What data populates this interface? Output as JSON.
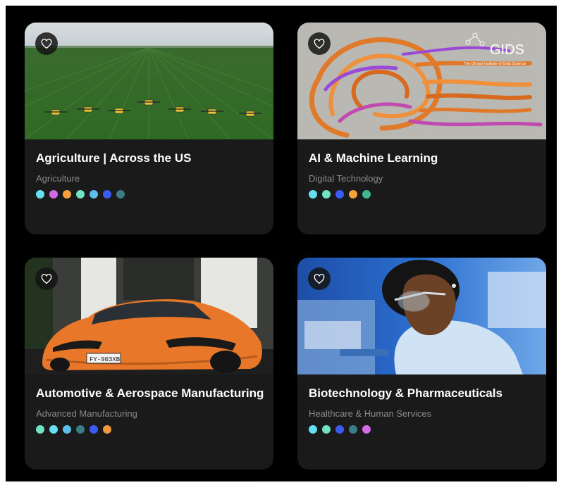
{
  "cards": [
    {
      "title": "Agriculture | Across the US",
      "category": "Agriculture",
      "image_icon": "agriculture-drones-image",
      "dots": [
        "#64e0f4",
        "#d36be6",
        "#f5a23b",
        "#71e3c2",
        "#5bc0eb",
        "#3b5bf5",
        "#3a7d88"
      ]
    },
    {
      "title": "AI & Machine Learning",
      "category": "Digital Technology",
      "image_icon": "ai-head-image",
      "logo_text": "GIDS",
      "logo_subtext": "The Global Institute of Data Science",
      "dots": [
        "#64e0f4",
        "#71e3c2",
        "#3b5bf5",
        "#f5a23b",
        "#3fb98a"
      ]
    },
    {
      "title": "Automotive & Aerospace Manufacturing",
      "category": "Advanced Manufacturing",
      "image_icon": "sports-car-image",
      "plate_text": "FY-903XB",
      "dots": [
        "#71e3c2",
        "#64e0f4",
        "#5bc0eb",
        "#3a7d88",
        "#3b5bf5",
        "#f59a3b"
      ]
    },
    {
      "title": "Biotechnology & Pharmaceuticals",
      "category": "Healthcare & Human Services",
      "image_icon": "scientist-lab-image",
      "dots": [
        "#64e0f4",
        "#71e3c2",
        "#3b5bf5",
        "#3a7d88",
        "#d36be6"
      ]
    }
  ]
}
